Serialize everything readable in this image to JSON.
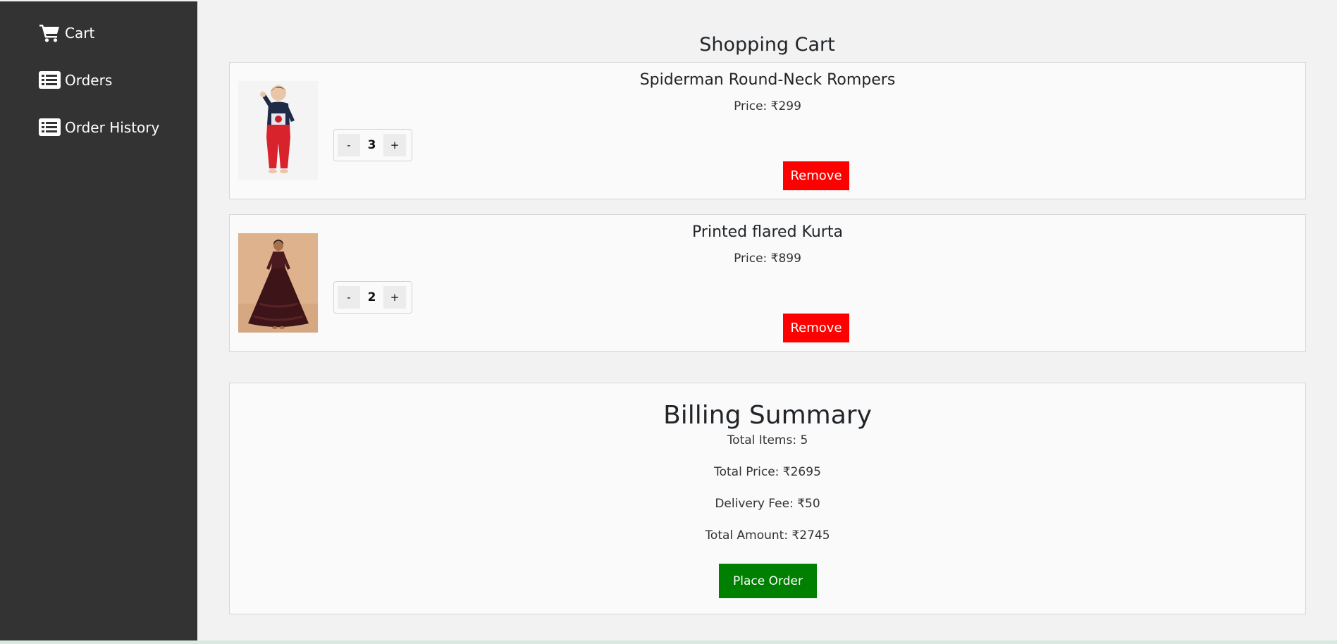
{
  "sidebar": {
    "items": [
      {
        "label": "Cart",
        "icon": "cart-icon"
      },
      {
        "label": "Orders",
        "icon": "list-icon"
      },
      {
        "label": "Order History",
        "icon": "list-icon"
      }
    ]
  },
  "main": {
    "title": "Shopping Cart",
    "cart_items": [
      {
        "name": "Spiderman Round-Neck Rompers",
        "price": "Price: ₹299",
        "quantity": "3",
        "decrement_label": "-",
        "increment_label": "+",
        "remove_label": "Remove"
      },
      {
        "name": "Printed flared Kurta",
        "price": "Price: ₹899",
        "quantity": "2",
        "decrement_label": "-",
        "increment_label": "+",
        "remove_label": "Remove"
      }
    ]
  },
  "billing": {
    "title": "Billing Summary",
    "total_items": "Total Items: 5",
    "total_price": "Total Price: ₹2695",
    "delivery_fee": "Delivery Fee: ₹50",
    "total_amount": "Total Amount: ₹2745",
    "place_order_label": "Place Order"
  },
  "colors": {
    "sidebar_bg": "#333333",
    "page_bg": "#f2f2f2",
    "remove_button": "#ff0000",
    "place_order_button": "#008000"
  }
}
